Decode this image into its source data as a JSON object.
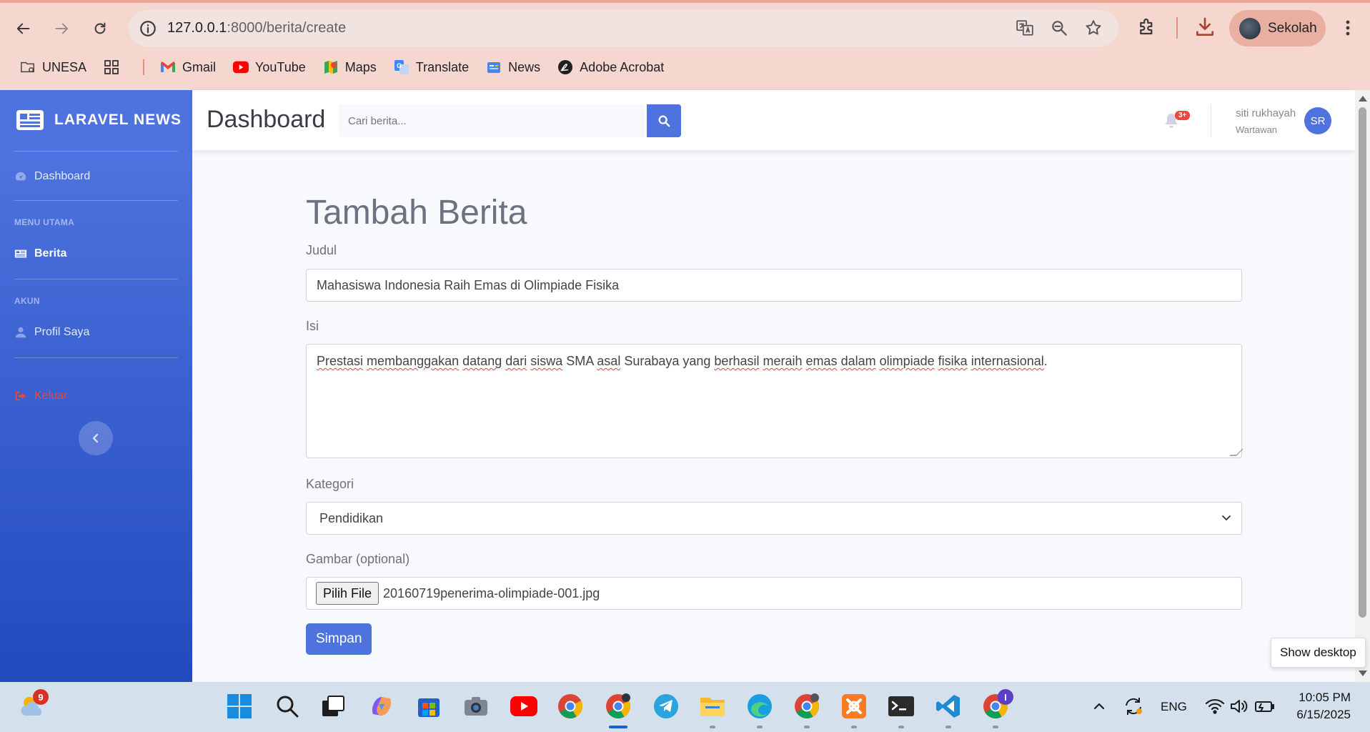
{
  "browser": {
    "url_host": "127.0.0.1",
    "url_path": ":8000/berita/create",
    "profile_name": "Sekolah",
    "bookmarks": [
      {
        "label": "UNESA",
        "icon": "folder-gear-icon"
      },
      {
        "label": "Gmail",
        "icon": "gmail-icon"
      },
      {
        "label": "YouTube",
        "icon": "youtube-icon"
      },
      {
        "label": "Maps",
        "icon": "maps-icon"
      },
      {
        "label": "Translate",
        "icon": "translate-icon"
      },
      {
        "label": "News",
        "icon": "news-icon"
      },
      {
        "label": "Adobe Acrobat",
        "icon": "acrobat-icon"
      }
    ]
  },
  "sidebar": {
    "brand": "LARAVEL NEWS",
    "dashboard": "Dashboard",
    "heading_main": "MENU UTAMA",
    "berita": "Berita",
    "heading_account": "AKUN",
    "profile": "Profil Saya",
    "logout": "Keluar"
  },
  "topbar": {
    "title": "Dashboard",
    "search_placeholder": "Cari berita...",
    "notif_badge": "3+",
    "user_name": "siti rukhayah",
    "user_role": "Wartawan",
    "user_initials": "SR"
  },
  "form": {
    "title": "Tambah Berita",
    "judul_label": "Judul",
    "judul_value": "Mahasiswa Indonesia Raih Emas di Olimpiade Fisika",
    "isi_label": "Isi",
    "isi_words": [
      {
        "t": "Prestasi",
        "s": true
      },
      {
        "t": " ",
        "s": false
      },
      {
        "t": "membanggakan",
        "s": true
      },
      {
        "t": " ",
        "s": false
      },
      {
        "t": "datang",
        "s": true
      },
      {
        "t": " ",
        "s": false
      },
      {
        "t": "dari",
        "s": true
      },
      {
        "t": " ",
        "s": false
      },
      {
        "t": "siswa",
        "s": true
      },
      {
        "t": " SMA ",
        "s": false
      },
      {
        "t": "asal",
        "s": true
      },
      {
        "t": " Surabaya yang ",
        "s": false
      },
      {
        "t": "berhasil",
        "s": true
      },
      {
        "t": " ",
        "s": false
      },
      {
        "t": "meraih",
        "s": true
      },
      {
        "t": " ",
        "s": false
      },
      {
        "t": "emas",
        "s": true
      },
      {
        "t": " ",
        "s": false
      },
      {
        "t": "dalam",
        "s": true
      },
      {
        "t": " ",
        "s": false
      },
      {
        "t": "olimpiade",
        "s": true
      },
      {
        "t": " ",
        "s": false
      },
      {
        "t": "fisika",
        "s": true
      },
      {
        "t": " ",
        "s": false
      },
      {
        "t": "internasional",
        "s": true
      },
      {
        "t": ".",
        "s": false
      }
    ],
    "kategori_label": "Kategori",
    "kategori_value": "Pendidikan",
    "gambar_label": "Gambar (optional)",
    "file_button": "Pilih File",
    "file_name": "20160719penerima-olimpiade-001.jpg",
    "submit": "Simpan"
  },
  "overlay": {
    "show_desktop": "Show desktop"
  },
  "taskbar": {
    "weather_badge": "9",
    "lang": "ENG",
    "time": "10:05 PM",
    "date": "6/15/2025",
    "chrome_badge": "I"
  },
  "colors": {
    "primary": "#4e73df",
    "danger": "#e74a3b",
    "chrome_bg": "#f6d7cf"
  }
}
